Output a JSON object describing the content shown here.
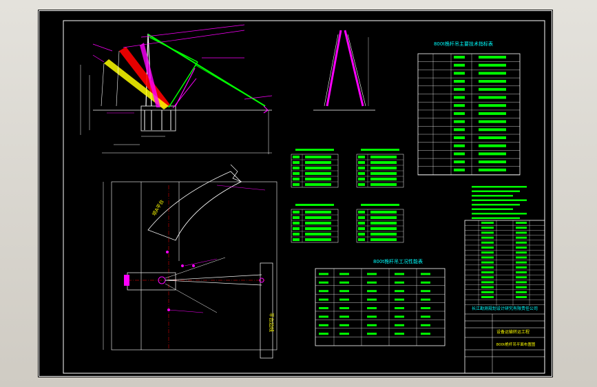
{
  "drawing": {
    "title_block": {
      "company": "长江勘测规划设计研究有限责任公司",
      "project": "设备运输转运工程",
      "drawing_name": "800t桅杆吊平面布置图"
    },
    "tables": {
      "main_spec_title": "800t桅杆吊主要技术指标表",
      "work_condition_title": "800t桅杆吊工况性能表"
    },
    "labels": {
      "left_slope": "坝A平台",
      "right_side": "平台边线"
    },
    "colors": {
      "background": "#000000",
      "border": "#ffffff",
      "line_green": "#00ff00",
      "line_cyan": "#00ffff",
      "accent_magenta": "#ff00ff",
      "accent_red": "#ff0000",
      "accent_yellow": "#ffff00"
    }
  }
}
